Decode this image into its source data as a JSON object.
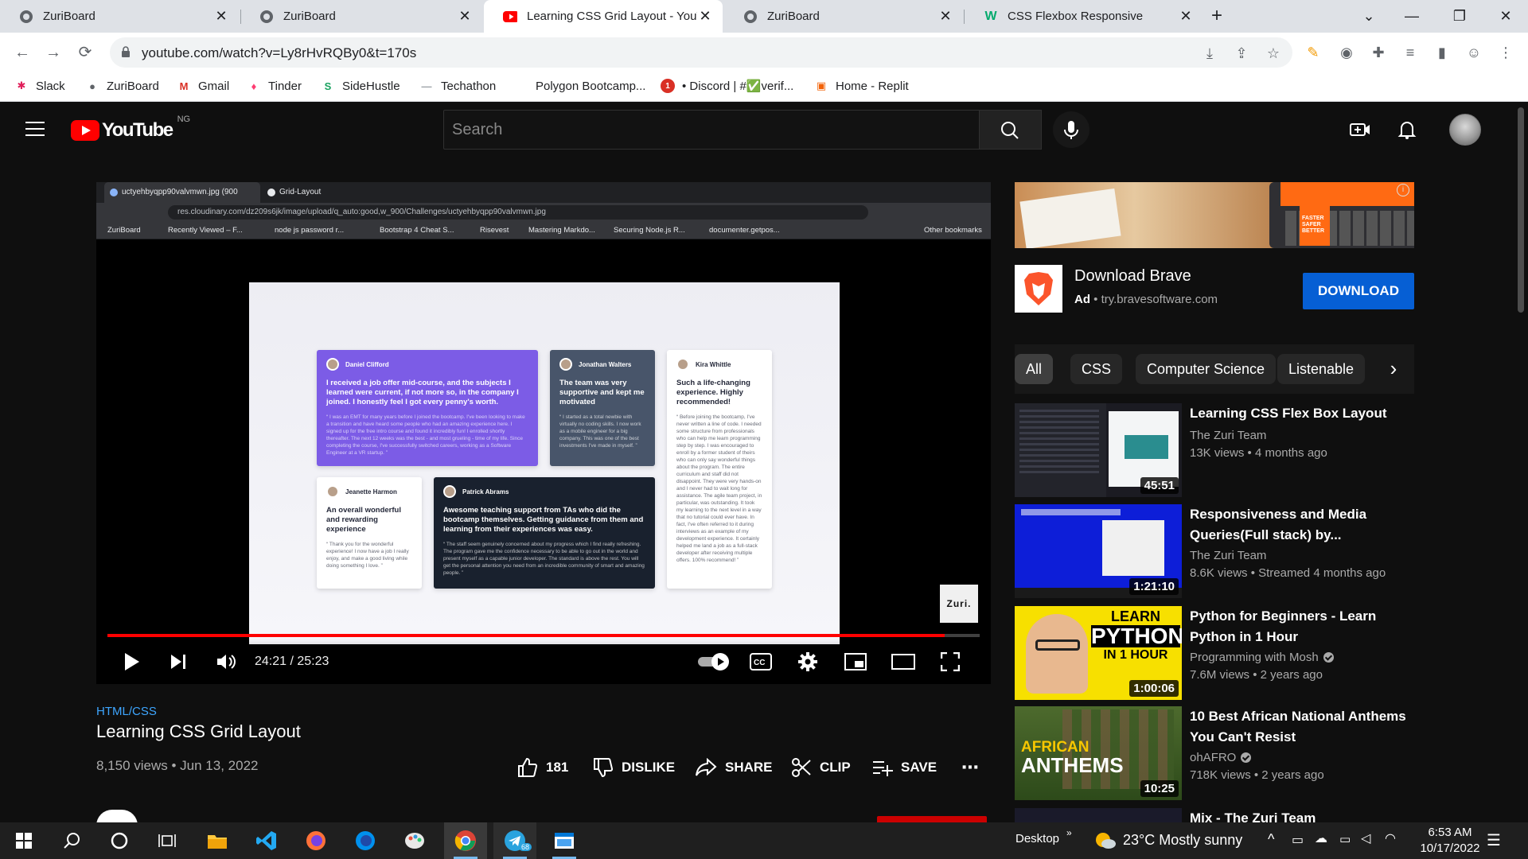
{
  "browser": {
    "tabs": [
      {
        "title": "ZuriBoard",
        "active": false
      },
      {
        "title": "ZuriBoard",
        "active": false
      },
      {
        "title": "Learning CSS Grid Layout - YouTube",
        "active": true
      },
      {
        "title": "ZuriBoard",
        "active": false
      },
      {
        "title": "CSS Flexbox Responsive",
        "active": false
      }
    ],
    "url": "youtube.com/watch?v=Ly8rHvRQBy0&t=170s",
    "bookmarks": [
      "Slack",
      "ZuriBoard",
      "Gmail",
      "Tinder",
      "SideHustle",
      "Techathon",
      "Polygon Bootcamp...",
      "• Discord | #✅verif...",
      "Home - Replit"
    ]
  },
  "youtube": {
    "logo_text": "YouTube",
    "country_code": "NG",
    "search_placeholder": "Search"
  },
  "player": {
    "inner_browser": {
      "tabs": [
        "uctyehbyqpp90valvmwn.jpg (900",
        "Grid-Layout"
      ],
      "url": "res.cloudinary.com/dz209s6jk/image/upload/q_auto:good,w_900/Challenges/uctyehbyqpp90valvmwn.jpg",
      "bookmarks": [
        "ZuriBoard",
        "Recently Viewed – F...",
        "node js password r...",
        "Bootstrap 4 Cheat S...",
        "Risevest",
        "Mastering Markdo...",
        "Securing Node.js R...",
        "documenter.getpos...",
        "Other bookmarks"
      ]
    },
    "testimonials": [
      {
        "name": "Daniel Clifford",
        "headline": "I received a job offer mid-course, and the subjects I learned were current, if not more so, in the company I joined. I honestly feel I got every penny's worth.",
        "body": "“ I was an EMT for many years before I joined the bootcamp. I've been looking to make a transition and have heard some people who had an amazing experience here. I signed up for the free intro course and found it incredibly fun! I enrolled shortly thereafter. The next 12 weeks was the best - and most grueling - time of my life. Since completing the course, I've successfully switched careers, working as a Software Engineer at a VR startup. ”"
      },
      {
        "name": "Jonathan Walters",
        "headline": "The team was very supportive and kept me motivated",
        "body": "“ I started as a total newbie with virtually no coding skills. I now work as a mobile engineer for a big company. This was one of the best investments I've made in myself. ”"
      },
      {
        "name": "Kira Whittle",
        "headline": "Such a life-changing experience. Highly recommended!",
        "body": "“ Before joining the bootcamp, I've never written a line of code. I needed some structure from professionals who can help me learn programming step by step. I was encouraged to enroll by a former student of theirs who can only say wonderful things about the program. The entire curriculum and staff did not disappoint. They were very hands-on and I never had to wait long for assistance. The agile team project, in particular, was outstanding. It took my learning to the next level in a way that no tutorial could ever have. In fact, I've often referred to it during interviews as an example of my development experience. It certainly helped me land a job as a full-stack developer after receiving multiple offers. 100% recommend! ”"
      },
      {
        "name": "Jeanette Harmon",
        "headline": "An overall wonderful and rewarding experience",
        "body": "“ Thank you for the wonderful experience! I now have a job I really enjoy, and make a good living while doing something I love. ”"
      },
      {
        "name": "Patrick Abrams",
        "headline": "Awesome teaching support from TAs who did the bootcamp themselves. Getting guidance from them and learning from their experiences was easy.",
        "body": "“ The staff seem genuinely concerned about my progress which I find really refreshing. The program gave me the confidence necessary to be able to go out in the world and present myself as a capable junior developer. The standard is above the rest. You will get the personal attention you need from an incredible community of smart and amazing people. ”"
      }
    ],
    "watermark": "Zuri.",
    "progress": 0.96,
    "time_current": "24:21",
    "time_total": "25:23",
    "time_display": "24:21 / 25:23"
  },
  "video": {
    "hashtag": "HTML/CSS",
    "title": "Learning CSS Grid Layout",
    "meta": "8,150 views • Jun 13, 2022",
    "actions": {
      "likes": "181",
      "dislike": "DISLIKE",
      "share": "SHARE",
      "clip": "CLIP",
      "save": "SAVE",
      "more": "⋯"
    }
  },
  "ad": {
    "title": "Download Brave",
    "label": "Ad",
    "domain": "try.bravesoftware.com",
    "button": "DOWNLOAD",
    "info": "i",
    "banner_text": "FASTER SAFER BETTER"
  },
  "chips": [
    "All",
    "CSS",
    "Computer Science",
    "Listenable"
  ],
  "recommendations": [
    {
      "title": "Learning CSS Flex Box Layout",
      "channel": "The Zuri Team",
      "verified": false,
      "stats": "13K views • 4 months ago",
      "duration": "45:51"
    },
    {
      "title": "Responsiveness and Media Queries(Full stack) by...",
      "channel": "The Zuri Team",
      "verified": false,
      "stats": "8.6K views • Streamed 4 months ago",
      "duration": "1:21:10"
    },
    {
      "title": "Python for Beginners - Learn Python in 1 Hour",
      "channel": "Programming with Mosh",
      "verified": true,
      "stats": "7.6M views • 2 years ago",
      "duration": "1:00:06",
      "thumb_text": [
        "LEARN",
        "PYTHON",
        "IN 1 HOUR"
      ]
    },
    {
      "title": "10 Best African National Anthems You Can't Resist",
      "channel": "ohAFRO",
      "verified": true,
      "stats": "718K views • 2 years ago",
      "duration": "10:25",
      "thumb_text": [
        "AFRICAN",
        "ANTHEMS"
      ]
    },
    {
      "title": "Mix - The Zuri Team",
      "channel": "",
      "stats": "",
      "duration": ""
    }
  ],
  "taskbar": {
    "desktop_label": "Desktop",
    "weather": "23°C  Mostly sunny",
    "time": "6:53 AM",
    "date": "10/17/2022",
    "telegram_badge": "68"
  },
  "colors": {
    "youtube_red": "#ff0000",
    "accent_blue": "#065fd4",
    "link_blue": "#3ea6ff",
    "page_bg": "#0f0f0f"
  }
}
